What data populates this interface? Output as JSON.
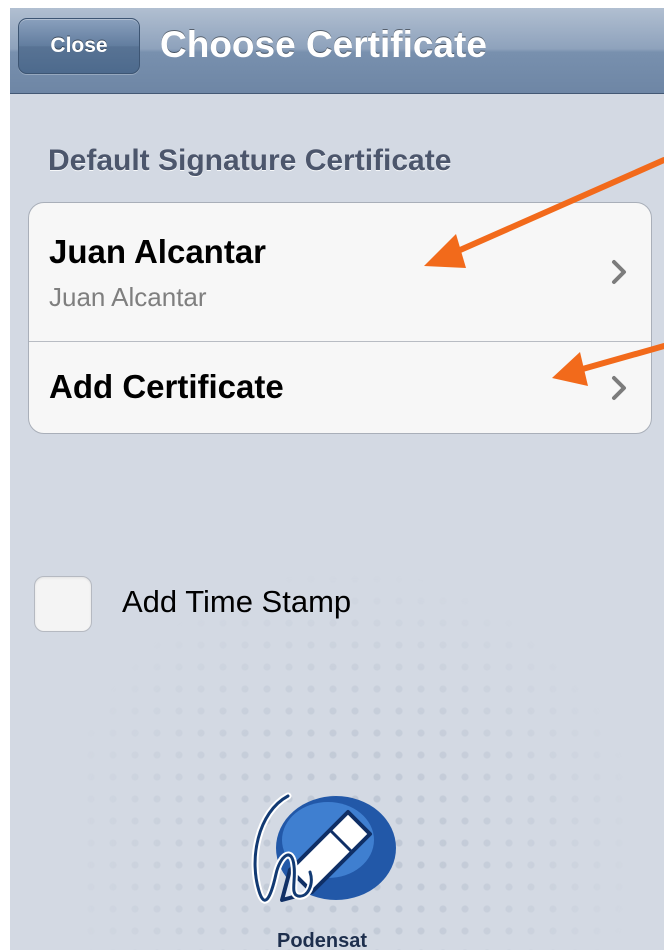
{
  "navbar": {
    "close_label": "Close",
    "title": "Choose Certificate"
  },
  "section": {
    "header": "Default Signature Certificate",
    "rows": [
      {
        "title": "Juan Alcantar",
        "subtitle": "Juan Alcantar"
      },
      {
        "title": "Add Certificate"
      }
    ]
  },
  "time_stamp": {
    "label": "Add Time Stamp",
    "checked": false
  },
  "logo": {
    "name": "Podensat"
  },
  "colors": {
    "navbar": "#8ea2bc",
    "background": "#d3d9e3",
    "annotation_arrow": "#f26a1b",
    "logo_blue": "#2258a8"
  },
  "icons": [
    "chevron-right-icon",
    "logo-pen-icon"
  ]
}
